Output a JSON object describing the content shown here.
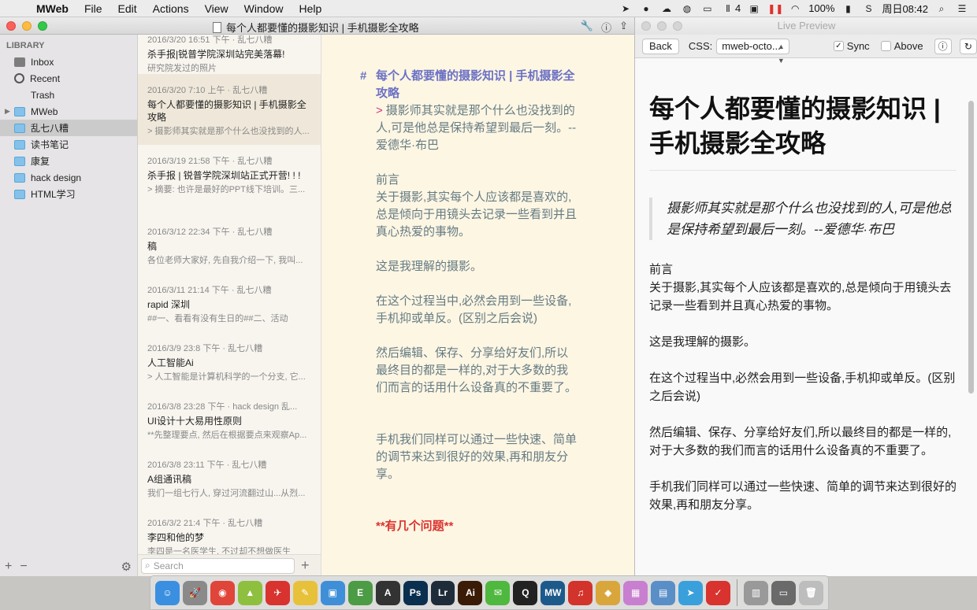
{
  "menubar": {
    "app": "MWeb",
    "items": [
      "File",
      "Edit",
      "Actions",
      "View",
      "Window",
      "Help"
    ],
    "tray_badge": "4",
    "battery": "100%",
    "clock": "周日08:42"
  },
  "window": {
    "title": "每个人都要懂的摄影知识 | 手机摄影全攻略"
  },
  "sidebar": {
    "heading": "LIBRARY",
    "items": [
      {
        "label": "Inbox"
      },
      {
        "label": "Recent"
      },
      {
        "label": "Trash"
      },
      {
        "label": "MWeb"
      },
      {
        "label": "乱七八糟"
      },
      {
        "label": "读书笔记"
      },
      {
        "label": "康复"
      },
      {
        "label": "hack design"
      },
      {
        "label": "HTML学习"
      }
    ]
  },
  "notes": [
    {
      "meta": "2016/3/20 16:51 下午 · 乱七八糟",
      "title": "杀手报|锐普学院深圳站完美落幕!",
      "excerpt": "研究院发过的照片"
    },
    {
      "meta": "2016/3/20 7:10 上午 · 乱七八糟",
      "title": "每个人都要懂的摄影知识 | 手机摄影全攻略",
      "excerpt": "> 摄影师其实就是那个什么也没找到的人..."
    },
    {
      "meta": "2016/3/19 21:58 下午 · 乱七八糟",
      "title": "杀手报 | 锐普学院深圳站正式开营! ! !",
      "excerpt": "> 摘要: 也许是最好的PPT线下培训。三..."
    },
    {
      "meta": "2016/3/12 22:34 下午 · 乱七八糟",
      "title": "稿",
      "excerpt": "各位老师大家好, 先自我介绍一下, 我叫..."
    },
    {
      "meta": "2016/3/11 21:14 下午 · 乱七八糟",
      "title": "rapid 深圳",
      "excerpt": "##一、看看有没有生日的##二、活动"
    },
    {
      "meta": "2016/3/9 23:8 下午 · 乱七八糟",
      "title": "人工智能Ai",
      "excerpt": "> 人工智能是计算机科学的一个分支, 它..."
    },
    {
      "meta": "2016/3/8 23:28 下午 · hack design 乱...",
      "title": "UI设计十大易用性原则",
      "excerpt": "**先整理要点, 然后在根据要点来观察Ap..."
    },
    {
      "meta": "2016/3/8 23:11 下午 · 乱七八糟",
      "title": "A组通讯稿",
      "excerpt": "我们一组七行人, 穿过河流翻过山...从烈..."
    },
    {
      "meta": "2016/3/2 21:4 下午 · 乱七八糟",
      "title": "李四和他的梦",
      "excerpt": "李四是一名医学生, 不过却不想做医生"
    }
  ],
  "search": {
    "placeholder": "Search"
  },
  "editor": {
    "heading": "每个人都要懂的摄影知识 | 手机摄影全攻略",
    "hash": "#",
    "quote_marker": ">",
    "quote": "摄影师其实就是那个什么也没找到的人,可是他总是保持希望到最后一刻。--爱德华·布巴",
    "preface_title": "前言",
    "preface": "关于摄影,其实每个人应该都是喜欢的,总是倾向于用镜头去记录一些看到并且真心热爱的事物。",
    "p2": "这是我理解的摄影。",
    "p3": "在这个过程当中,必然会用到一些设备,手机抑或单反。(区别之后会说)",
    "p4": "然后编辑、保存、分享给好友们,所以最终目的都是一样的,对于大多数的我们而言的话用什么设备真的不重要了。",
    "p5": "手机我们同样可以通过一些快速、简单的调节来达到很好的效果,再和朋友分享。",
    "bold": "**有几个问题**"
  },
  "preview": {
    "title": "Live Preview",
    "back_label": "Back",
    "css_label": "CSS:",
    "css_value": "mweb-octo...",
    "sync_label": "Sync",
    "sync_checked": true,
    "above_label": "Above",
    "above_checked": false,
    "h1": "每个人都要懂的摄影知识 | 手机摄影全攻略",
    "quote": "摄影师其实就是那个什么也没找到的人,可是他总是保持希望到最后一刻。--爱德华·布巴",
    "preface_title": "前言",
    "preface": "关于摄影,其实每个人应该都是喜欢的,总是倾向于用镜头去记录一些看到并且真心热爱的事物。",
    "p2": "这是我理解的摄影。",
    "p3": "在这个过程当中,必然会用到一些设备,手机抑或单反。(区别之后会说)",
    "p4": "然后编辑、保存、分享给好友们,所以最终目的都是一样的,对于大多数的我们而言的话用什么设备真的不重要了。",
    "p5": "手机我们同样可以通过一些快速、简单的调节来达到很好的效果,再和朋友分享。"
  },
  "dock": {
    "apps": [
      {
        "name": "Finder",
        "color": "#3b8fe0",
        "glyph": "☺"
      },
      {
        "name": "Launchpad",
        "color": "#8a8a8a",
        "glyph": "🚀"
      },
      {
        "name": "Chrome",
        "color": "#e0453a",
        "glyph": "◉"
      },
      {
        "name": "Android",
        "color": "#8fbf3f",
        "glyph": "▲"
      },
      {
        "name": "Airmail",
        "color": "#d8332f",
        "glyph": "✈"
      },
      {
        "name": "Notes",
        "color": "#e8c13a",
        "glyph": "✎"
      },
      {
        "name": "Keynote",
        "color": "#3f8fd8",
        "glyph": "▣"
      },
      {
        "name": "Evernote",
        "color": "#4c9b45",
        "glyph": "E"
      },
      {
        "name": "Typora",
        "color": "#333333",
        "glyph": "A"
      },
      {
        "name": "Photoshop",
        "color": "#0b2f4f",
        "glyph": "Ps"
      },
      {
        "name": "Lightroom",
        "color": "#1e2c3a",
        "glyph": "Lr"
      },
      {
        "name": "Illustrator",
        "color": "#3a1b06",
        "glyph": "Ai"
      },
      {
        "name": "WeChat",
        "color": "#4fb83f",
        "glyph": "✉"
      },
      {
        "name": "QQ",
        "color": "#222222",
        "glyph": "Q"
      },
      {
        "name": "MWeb",
        "color": "#1d5a8c",
        "glyph": "MW"
      },
      {
        "name": "NetEase Music",
        "color": "#d2332b",
        "glyph": "♫"
      },
      {
        "name": "Sketch",
        "color": "#d9a63c",
        "glyph": "◆"
      },
      {
        "name": "Preview",
        "color": "#c97fd0",
        "glyph": "▦"
      },
      {
        "name": "Screen Capture",
        "color": "#5a8ec7",
        "glyph": "▤"
      },
      {
        "name": "Telegram",
        "color": "#3aa0dc",
        "glyph": "➤"
      },
      {
        "name": "Wunderlist",
        "color": "#d8332f",
        "glyph": "✓"
      },
      {
        "name": "Printer",
        "color": "#999999",
        "glyph": "▥"
      },
      {
        "name": "Downloads",
        "color": "#6a6a6a",
        "glyph": "▭"
      },
      {
        "name": "Trash",
        "color": "#bdbdbd",
        "glyph": "🗑"
      }
    ]
  }
}
